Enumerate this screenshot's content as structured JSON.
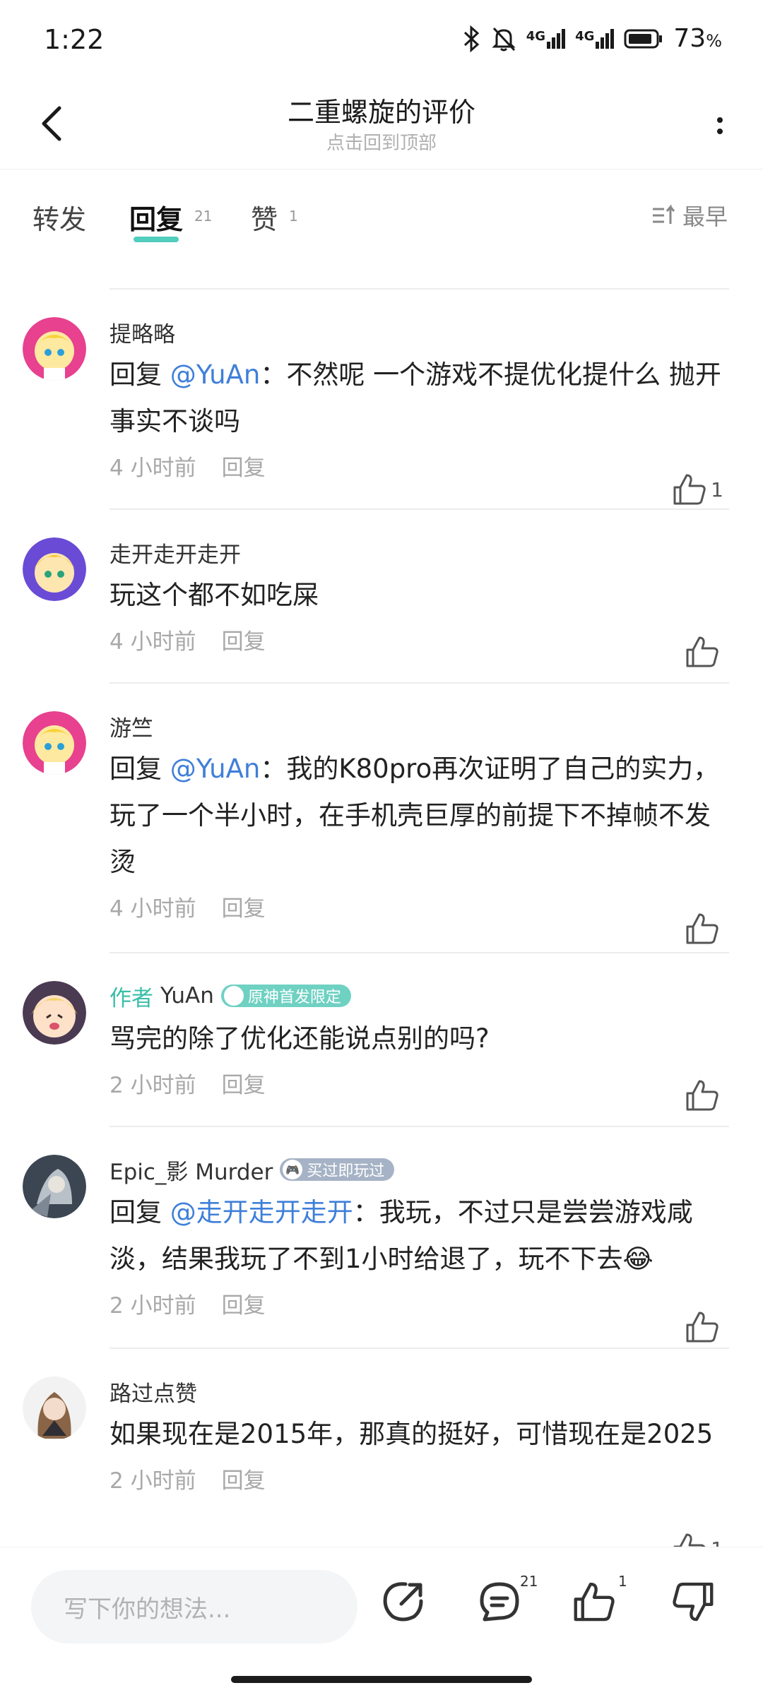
{
  "status": {
    "time": "1:22",
    "battery": "73",
    "battery_unit": "%",
    "net1": "4G",
    "net2": "4G"
  },
  "header": {
    "title": "二重螺旋的评价",
    "subtitle": "点击回到顶部"
  },
  "tabs": [
    {
      "label": "转发",
      "count": ""
    },
    {
      "label": "回复",
      "count": "21"
    },
    {
      "label": "赞",
      "count": "1"
    }
  ],
  "sort_label": "最早",
  "comments": [
    {
      "author": "提略略",
      "is_author": false,
      "badge": "",
      "reply_prefix": "回复 ",
      "mention": "@YuAn",
      "text": "：不然呢 一个游戏不提优化提什么 抛开事实不谈吗",
      "time": "4 小时前",
      "reply": "回复",
      "likes": "1"
    },
    {
      "author": "走开走开走开",
      "is_author": false,
      "badge": "",
      "reply_prefix": "",
      "mention": "",
      "text": "玩这个都不如吃屎",
      "time": "4 小时前",
      "reply": "回复",
      "likes": ""
    },
    {
      "author": "游竺",
      "is_author": false,
      "badge": "",
      "reply_prefix": "回复 ",
      "mention": "@YuAn",
      "text": "：我的K80pro再次证明了自己的实力，玩了一个半小时，在手机壳巨厚的前提下不掉帧不发烫",
      "time": "4 小时前",
      "reply": "回复",
      "likes": ""
    },
    {
      "author": "YuAn",
      "is_author": true,
      "author_tag": "作者",
      "badge": "原神首发限定",
      "reply_prefix": "",
      "mention": "",
      "text": "骂完的除了优化还能说点别的吗?",
      "time": "2 小时前",
      "reply": "回复",
      "likes": ""
    },
    {
      "author": "Epic_影 Murder",
      "is_author": false,
      "badge": "买过即玩过",
      "reply_prefix": "回复 ",
      "mention": "@走开走开走开",
      "text": "：我玩，不过只是尝尝游戏咸淡，结果我玩了不到1小时给退了，玩不下去😂",
      "time": "2 小时前",
      "reply": "回复",
      "likes": ""
    },
    {
      "author": "路过点赞",
      "is_author": false,
      "badge": "",
      "reply_prefix": "",
      "mention": "",
      "text": "如果现在是2015年，那真的挺好，可惜现在是2025",
      "time": "2 小时前",
      "reply": "回复",
      "likes": "1"
    }
  ],
  "bottom": {
    "placeholder": "写下你的想法...",
    "comment_count": "21",
    "like_count": "1"
  },
  "colors": {
    "accent": "#3ec9b6",
    "mention": "#3f7fd9",
    "author_tag": "#38bfa7"
  }
}
